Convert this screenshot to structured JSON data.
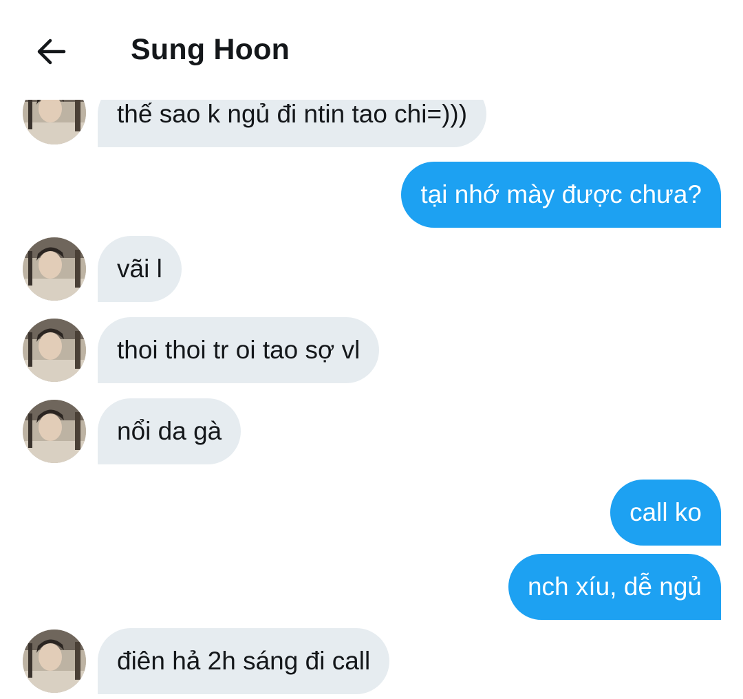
{
  "header": {
    "title": "Sung Hoon",
    "back_icon": "arrow-left-icon"
  },
  "colors": {
    "incoming_bubble": "#e6ecf0",
    "outgoing_bubble": "#1da1f2",
    "text": "#14171a"
  },
  "messages": [
    {
      "from": "contact",
      "text": "thế sao k ngủ đi ntin tao chi=)))"
    },
    {
      "from": "me",
      "text": "tại nhớ mày được chưa?"
    },
    {
      "from": "contact",
      "text": "vãi l"
    },
    {
      "from": "contact",
      "text": "thoi thoi tr oi tao sợ vl"
    },
    {
      "from": "contact",
      "text": "nổi da gà"
    },
    {
      "from": "me",
      "text": "call ko"
    },
    {
      "from": "me",
      "text": "nch xíu, dễ ngủ"
    },
    {
      "from": "contact",
      "text": "điên hả 2h sáng đi call"
    }
  ]
}
